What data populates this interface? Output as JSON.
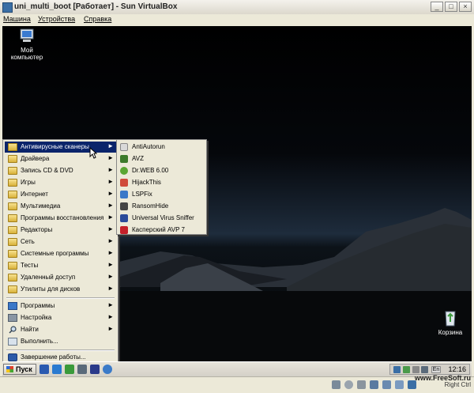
{
  "window": {
    "title": "uni_multi_boot [Работает] - Sun VirtualBox",
    "minimize": "_",
    "maximize": "□",
    "close": "×"
  },
  "menubar": [
    "Машина",
    "Устройства",
    "Справка"
  ],
  "desktop_icons": {
    "my_computer": [
      "Мой",
      "компьютер"
    ],
    "recycle_bin": "Корзина"
  },
  "start_menu": {
    "items": [
      {
        "label": "Антивирусные сканеры",
        "selected": true
      },
      {
        "label": "Драйвера"
      },
      {
        "label": "Запись CD & DVD"
      },
      {
        "label": "Игры"
      },
      {
        "label": "Интернет"
      },
      {
        "label": "Мультимедиа"
      },
      {
        "label": "Программы восстановления"
      },
      {
        "label": "Редакторы"
      },
      {
        "label": "Сеть"
      },
      {
        "label": "Системные программы"
      },
      {
        "label": "Тесты"
      },
      {
        "label": "Удаленный доступ"
      },
      {
        "label": "Утилиты для дисков"
      }
    ],
    "bottom_items": [
      {
        "label": "Программы",
        "icon": "programs-icon"
      },
      {
        "label": "Настройка",
        "icon": "settings-icon"
      },
      {
        "label": "Найти",
        "icon": "search-icon"
      },
      {
        "label": "Выполнить...",
        "icon": "run-icon"
      },
      {
        "label": "Завершение работы...",
        "icon": "shutdown-icon"
      }
    ]
  },
  "antivirus_submenu": [
    {
      "label": "AntiAutorun",
      "color": "#d9d9d9"
    },
    {
      "label": "AVZ",
      "color": "#3c7a2a"
    },
    {
      "label": "Dr.WEB 6.00",
      "color": "#5aa632"
    },
    {
      "label": "HijackThis",
      "color": "#d04a3a"
    },
    {
      "label": "LSPFix",
      "color": "#3a78c8"
    },
    {
      "label": "RansomHide",
      "color": "#444444"
    },
    {
      "label": "Universal Virus Sniffer",
      "color": "#2a4a9a"
    },
    {
      "label": "Касперский AVP 7",
      "color": "#c4202a"
    }
  ],
  "taskbar": {
    "start_label": "Пуск",
    "tray_language": "En",
    "clock": "12:16"
  },
  "statusbar": {
    "host_key": "Right Ctrl",
    "watermark": "www.FreeSoft.ru"
  }
}
